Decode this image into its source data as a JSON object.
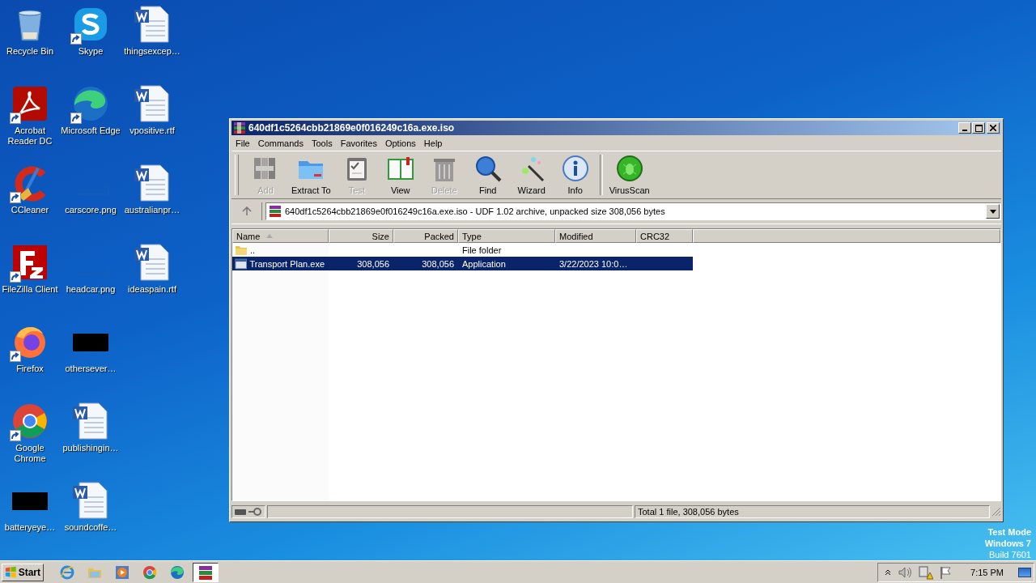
{
  "desktop_icons": [
    {
      "label": "Recycle Bin",
      "kind": "recycle",
      "shortcut": false
    },
    {
      "label": "Acrobat Reader DC",
      "kind": "acrobat",
      "shortcut": true
    },
    {
      "label": "CCleaner",
      "kind": "ccleaner",
      "shortcut": true
    },
    {
      "label": "FileZilla Client",
      "kind": "filezilla",
      "shortcut": true
    },
    {
      "label": "Firefox",
      "kind": "firefox",
      "shortcut": true
    },
    {
      "label": "Google Chrome",
      "kind": "chrome",
      "shortcut": true
    },
    {
      "label": "batteryeye…",
      "kind": "black",
      "shortcut": false
    },
    {
      "label": "Skype",
      "kind": "skype",
      "shortcut": true
    },
    {
      "label": "Microsoft Edge",
      "kind": "edge",
      "shortcut": true
    },
    {
      "label": "carscore.png",
      "kind": "blank",
      "shortcut": false
    },
    {
      "label": "headcar.png",
      "kind": "blank",
      "shortcut": false
    },
    {
      "label": "othersever…",
      "kind": "black",
      "shortcut": false
    },
    {
      "label": "publishingin…",
      "kind": "word",
      "shortcut": false
    },
    {
      "label": "soundcoffe…",
      "kind": "word",
      "shortcut": false
    },
    {
      "label": "thingsexcep…",
      "kind": "word",
      "shortcut": false
    },
    {
      "label": "vpositive.rtf",
      "kind": "word",
      "shortcut": false
    },
    {
      "label": "australianpr…",
      "kind": "word",
      "shortcut": false
    },
    {
      "label": "ideaspain.rtf",
      "kind": "word",
      "shortcut": false
    }
  ],
  "window": {
    "title": "640df1c5264cbb21869e0f016249c16a.exe.iso",
    "menu": [
      "File",
      "Commands",
      "Tools",
      "Favorites",
      "Options",
      "Help"
    ],
    "toolbar": [
      {
        "label": "Add",
        "kind": "add",
        "disabled": true
      },
      {
        "label": "Extract To",
        "kind": "extract",
        "disabled": false
      },
      {
        "label": "Test",
        "kind": "test",
        "disabled": true
      },
      {
        "label": "View",
        "kind": "view",
        "disabled": false
      },
      {
        "label": "Delete",
        "kind": "delete",
        "disabled": true
      },
      {
        "label": "Find",
        "kind": "find",
        "disabled": false
      },
      {
        "label": "Wizard",
        "kind": "wizard",
        "disabled": false
      },
      {
        "label": "Info",
        "kind": "info",
        "disabled": false
      },
      {
        "label": "VirusScan",
        "kind": "virus",
        "disabled": false
      }
    ],
    "address": "640df1c5264cbb21869e0f016249c16a.exe.iso - UDF 1.02 archive, unpacked size 308,056 bytes",
    "columns": [
      {
        "label": "Name",
        "sorted": true
      },
      {
        "label": "Size",
        "sorted": false
      },
      {
        "label": "Packed",
        "sorted": false
      },
      {
        "label": "Type",
        "sorted": false
      },
      {
        "label": "Modified",
        "sorted": false
      },
      {
        "label": "CRC32",
        "sorted": false
      }
    ],
    "rows": [
      {
        "kind": "folder",
        "name": "..",
        "type": "File folder",
        "selected": false
      },
      {
        "kind": "exe",
        "name": "Transport Plan.exe",
        "size": "308,056",
        "packed": "308,056",
        "type": "Application",
        "modified": "3/22/2023 10:0…",
        "selected": true
      }
    ],
    "status": "Total 1 file, 308,056 bytes"
  },
  "os_notice": [
    "Test Mode",
    "Windows 7",
    "Build 7601"
  ],
  "taskbar": {
    "start": "Start",
    "apps": [
      {
        "kind": "ie",
        "selected": false
      },
      {
        "kind": "folder",
        "selected": false
      },
      {
        "kind": "media",
        "selected": false
      },
      {
        "kind": "chrome",
        "selected": false
      },
      {
        "kind": "edge",
        "selected": false
      },
      {
        "kind": "winrar",
        "selected": true
      }
    ],
    "clock": "7:15 PM"
  }
}
